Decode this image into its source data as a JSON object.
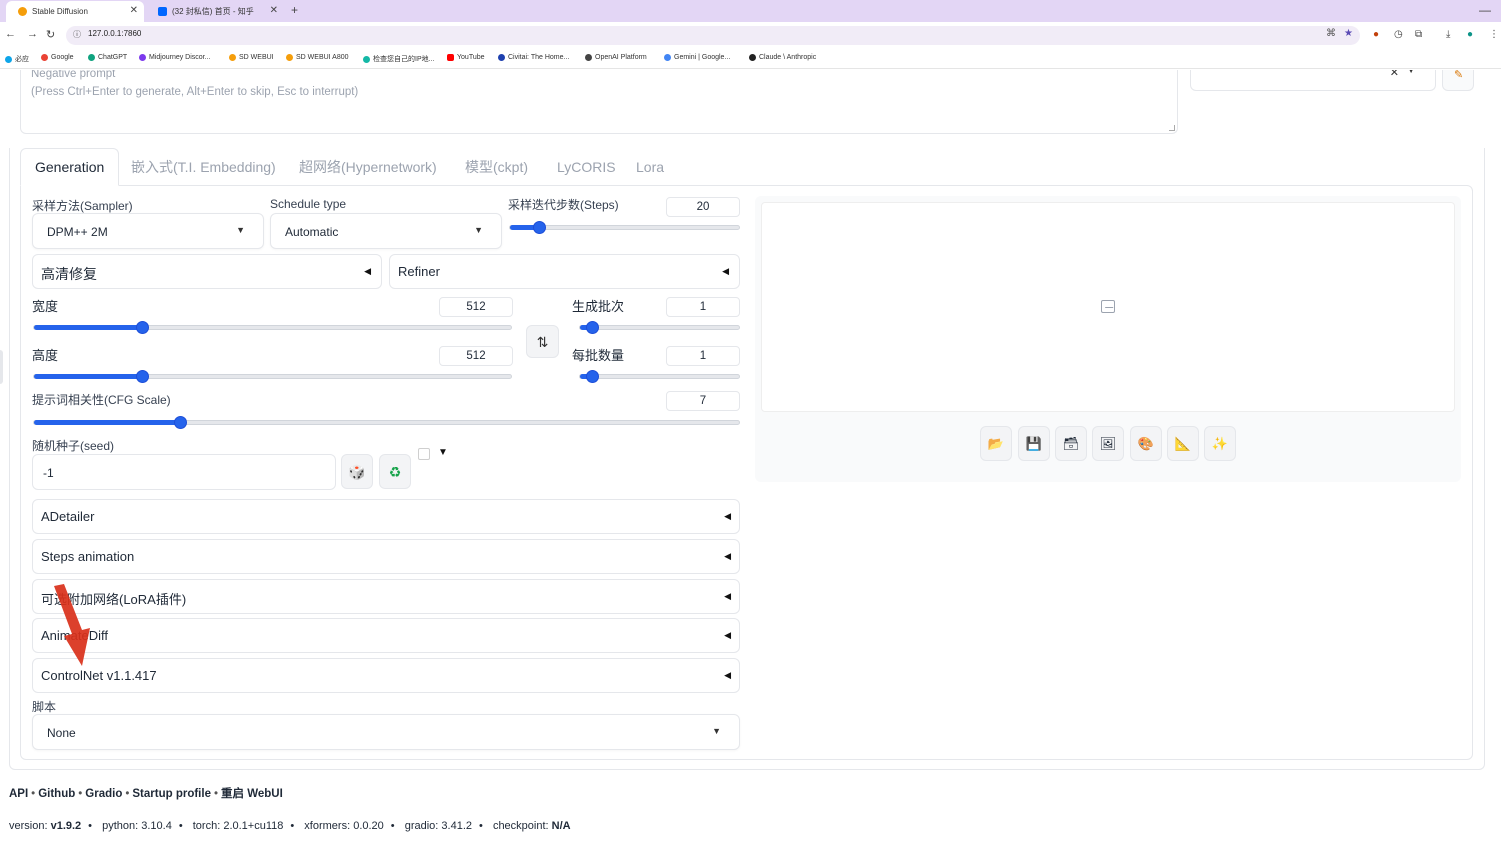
{
  "browser": {
    "tabs": [
      {
        "title": "Stable Diffusion",
        "active": true,
        "color": "#f59e0b"
      },
      {
        "title": "(32 封私信) 首页 - 知乎",
        "active": false,
        "color": "#0066ff"
      }
    ],
    "url": "127.0.0.1:7860",
    "bookmarks": [
      {
        "label": "必应",
        "color": "#0ea5e9"
      },
      {
        "label": "Google",
        "color": "#ea4335"
      },
      {
        "label": "ChatGPT",
        "color": "#10a37f"
      },
      {
        "label": "Midjourney Discor...",
        "color": "#7c3aed"
      },
      {
        "label": "SD WEBUI",
        "color": "#f59e0b"
      },
      {
        "label": "SD WEBUI A800",
        "color": "#f59e0b"
      },
      {
        "label": "检查您自己的IP地...",
        "color": "#14b8a6"
      },
      {
        "label": "YouTube",
        "color": "#ff0000"
      },
      {
        "label": "Civitai: The Home...",
        "color": "#1e40af"
      },
      {
        "label": "OpenAI Platform",
        "color": "#444444"
      },
      {
        "label": "Gemini | Google...",
        "color": "#4285f4"
      },
      {
        "label": "Claude \\ Anthropic",
        "color": "#222222"
      }
    ]
  },
  "prompt": {
    "negative_placeholder_line1": "Negative prompt",
    "negative_placeholder_line2": "(Press Ctrl+Enter to generate, Alt+Enter to skip, Esc to interrupt)"
  },
  "tabs": [
    "Generation",
    "嵌入式(T.I. Embedding)",
    "超网络(Hypernetwork)",
    "模型(ckpt)",
    "LyCORIS",
    "Lora"
  ],
  "sampler": {
    "label": "采样方法(Sampler)",
    "value": "DPM++ 2M"
  },
  "schedule": {
    "label": "Schedule type",
    "value": "Automatic"
  },
  "steps": {
    "label": "采样迭代步数(Steps)",
    "value": "20",
    "min": 1,
    "max": 150,
    "current": 20
  },
  "hires": {
    "label": "高清修复"
  },
  "refiner": {
    "label": "Refiner"
  },
  "width": {
    "label": "宽度",
    "value": "512",
    "min": 64,
    "max": 2048,
    "current": 512
  },
  "height": {
    "label": "高度",
    "value": "512",
    "min": 64,
    "max": 2048,
    "current": 512
  },
  "batch_count": {
    "label": "生成批次",
    "value": "1",
    "min": 1,
    "max": 100,
    "current": 1
  },
  "batch_size": {
    "label": "每批数量",
    "value": "1",
    "min": 1,
    "max": 8,
    "current": 1
  },
  "cfg": {
    "label": "提示词相关性(CFG Scale)",
    "value": "7",
    "min": 1,
    "max": 30,
    "current": 7
  },
  "seed": {
    "label": "随机种子(seed)",
    "value": "-1"
  },
  "accordions": [
    "ADetailer",
    "Steps animation",
    "可选附加网络(LoRA插件)",
    "AnimateDiff",
    "ControlNet v1.1.417"
  ],
  "script": {
    "label": "脚本",
    "value": "None"
  },
  "footer": {
    "links": [
      "API",
      "Github",
      "Gradio",
      "Startup profile",
      "重启 WebUI"
    ],
    "versions": [
      {
        "key": "version: ",
        "val": "v1.9.2",
        "bold": true
      },
      {
        "key": "python: ",
        "val": "3.10.4",
        "bold": false
      },
      {
        "key": "torch: ",
        "val": "2.0.1+cu118",
        "bold": false
      },
      {
        "key": "xformers: ",
        "val": "0.0.20",
        "bold": false
      },
      {
        "key": "gradio: ",
        "val": "3.41.2",
        "bold": false
      },
      {
        "key": "checkpoint: ",
        "val": "N/A",
        "bold": true
      }
    ]
  },
  "colors": {
    "accent": "#2563eb",
    "annotation": "#d9301a"
  }
}
